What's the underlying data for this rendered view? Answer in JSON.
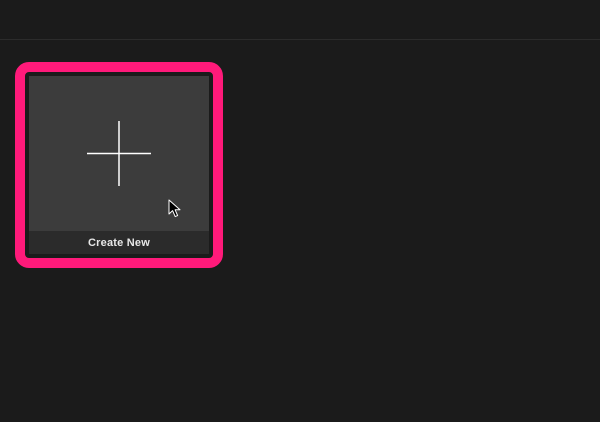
{
  "card": {
    "label": "Create New",
    "icon": "plus-icon"
  },
  "colors": {
    "background": "#1b1b1b",
    "card": "#3c3c3c",
    "label_bar": "#2b2b2b",
    "highlight": "#ff1a7a",
    "plus": "#ffffff"
  },
  "cursor": {
    "icon": "mouse-pointer-icon"
  }
}
